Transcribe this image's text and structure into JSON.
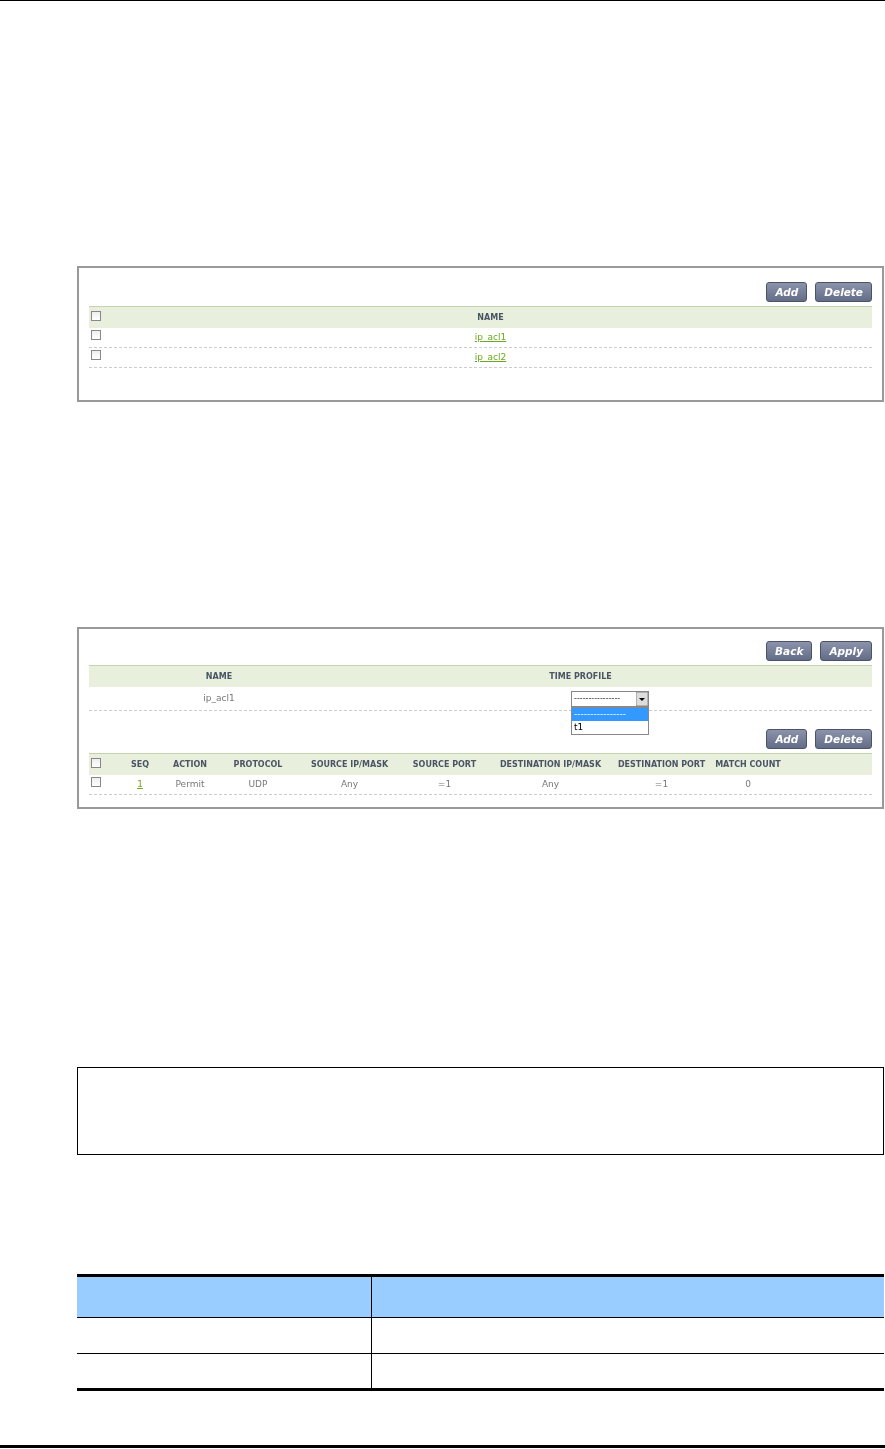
{
  "acl_list": {
    "buttons": [
      "Add",
      "Delete"
    ],
    "select_all_checked": false,
    "columns": [
      "NAME"
    ],
    "rows": [
      {
        "name": "ip_acl1",
        "checked": false
      },
      {
        "name": "ip_acl2",
        "checked": false
      }
    ]
  },
  "acl_detail": {
    "buttons": [
      "Back",
      "Apply"
    ],
    "columns": [
      "NAME",
      "TIME PROFILE"
    ],
    "name": "ip_acl1",
    "time_profile": {
      "value": "----------------",
      "expanded": true,
      "options": [
        {
          "label": "----------------",
          "selected": true
        },
        {
          "label": "t1",
          "selected": false
        }
      ]
    },
    "rule_buttons": [
      "Add",
      "Delete"
    ],
    "rule_select_all_checked": false,
    "rule_columns": [
      "SEQ",
      "ACTION",
      "PROTOCOL",
      "SOURCE IP/MASK",
      "SOURCE PORT",
      "DESTINATION IP/MASK",
      "DESTINATION PORT",
      "MATCH COUNT"
    ],
    "rules": [
      {
        "checked": false,
        "cells": [
          "1",
          "Permit",
          "UDP",
          "Any",
          "=1",
          "Any",
          "=1",
          "0"
        ]
      }
    ]
  }
}
